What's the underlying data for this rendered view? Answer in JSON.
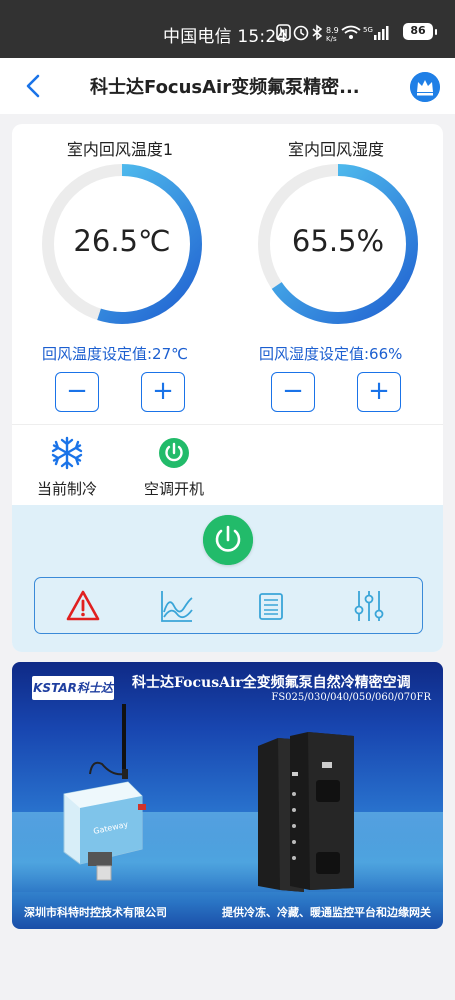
{
  "status_bar": {
    "carrier_time": "中国电信 15:24",
    "speed": "8.9 K/s",
    "battery": "86",
    "icons": [
      "nfc-icon",
      "alarm-icon",
      "bluetooth-icon",
      "wifi-icon",
      "signal-icon",
      "battery-icon"
    ]
  },
  "header": {
    "title": "科士达FocusAir变频氟泵精密...",
    "back_icon": "back-chevron-icon",
    "vip_icon": "crown-icon"
  },
  "gauges": [
    {
      "label": "室内回风温度1",
      "value": "26.5℃",
      "fill_fraction": 0.55,
      "setpoint": "回风温度设定值:27℃"
    },
    {
      "label": "室内回风湿度",
      "value": "65.5%",
      "fill_fraction": 0.655,
      "setpoint": "回风湿度设定值:66%"
    }
  ],
  "steppers": {
    "minus": "−",
    "plus": "+"
  },
  "status_items": [
    {
      "label": "当前制冷",
      "icon": "snowflake-icon"
    },
    {
      "label": "空调开机",
      "icon": "power-on-icon"
    }
  ],
  "controls": {
    "power_icon": "power-button-icon",
    "tools": [
      "alarm-warning-icon",
      "trend-chart-icon",
      "list-icon",
      "settings-sliders-icon"
    ]
  },
  "banner": {
    "logo": "KSTAR科士达",
    "title": "科士达FocusAir全变频氟泵自然冷精密空调",
    "model": "FS025/030/040/050/060/070FR",
    "footer_left": "深圳市科特时控技术有限公司",
    "footer_right": "提供冷冻、冷藏、暖通监控平台和边缘网关",
    "gateway_label": "Gateway"
  },
  "colors": {
    "accent": "#1a73e8",
    "gauge_start": "#1f5fd0",
    "gauge_end": "#5cd4f5",
    "power_green": "#22bb6a",
    "alarm_red": "#e02020",
    "panel_bg": "#dff0f9"
  }
}
